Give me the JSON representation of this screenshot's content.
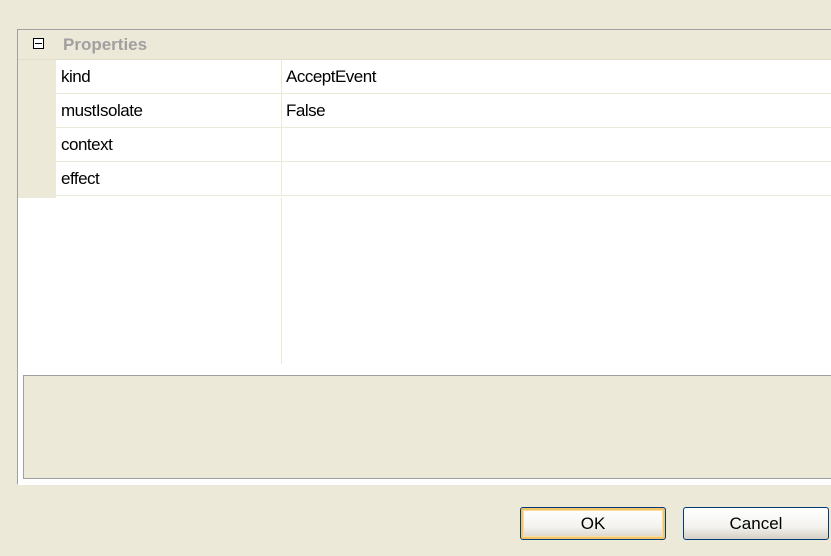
{
  "property_grid": {
    "category": {
      "label": "Properties",
      "expanded": true
    },
    "properties": [
      {
        "name": "kind",
        "value": "AcceptEvent"
      },
      {
        "name": "mustIsolate",
        "value": "False"
      },
      {
        "name": "context",
        "value": ""
      },
      {
        "name": "effect",
        "value": ""
      }
    ],
    "description": ""
  },
  "buttons": {
    "ok_label": "OK",
    "cancel_label": "Cancel"
  },
  "colors": {
    "window_background": "#ece9d8",
    "grid_background": "#ffffff",
    "category_text": "#a0a0a0",
    "default_button_border": "#f2c56b"
  },
  "icons": {
    "category_toggle": "collapse-minus-icon"
  }
}
